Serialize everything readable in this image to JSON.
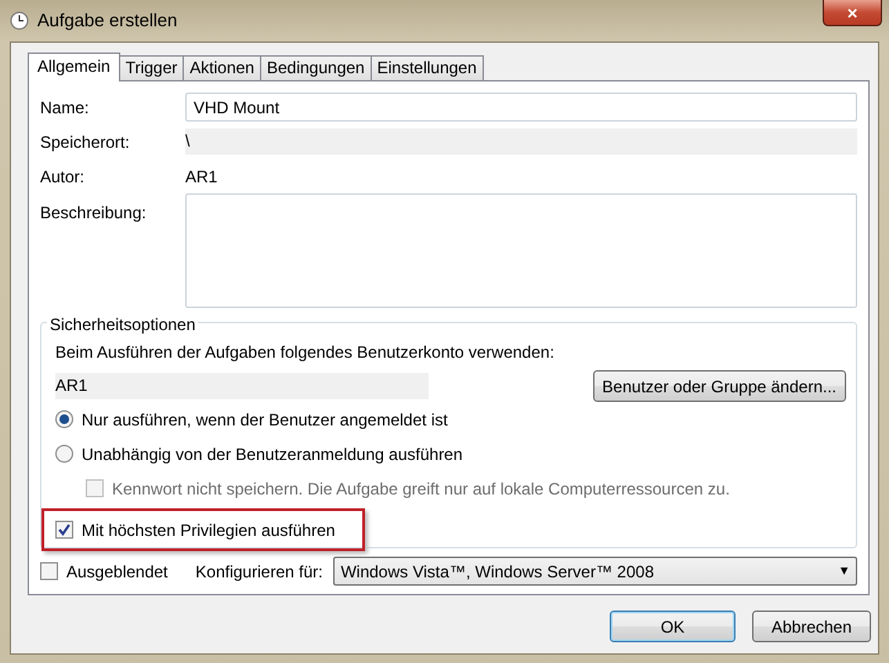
{
  "window": {
    "title": "Aufgabe erstellen",
    "close": "×"
  },
  "tabs": [
    {
      "label": "Allgemein",
      "selected": true
    },
    {
      "label": "Trigger",
      "selected": false
    },
    {
      "label": "Aktionen",
      "selected": false
    },
    {
      "label": "Bedingungen",
      "selected": false
    },
    {
      "label": "Einstellungen",
      "selected": false
    }
  ],
  "fields": [
    {
      "label": "Name:",
      "kind": "input",
      "value": "VHD Mount"
    },
    {
      "label": "Speicherort:",
      "kind": "readonly",
      "value": "\\"
    },
    {
      "label": "Autor:",
      "kind": "plain",
      "value": "AR1"
    },
    {
      "label": "Beschreibung:",
      "kind": "textarea"
    }
  ],
  "security": {
    "title": "Sicherheitsoptionen",
    "account_label": "Beim Ausführen der Aufgaben folgendes Benutzerkonto verwenden:",
    "account": "AR1",
    "change_button": "Benutzer oder Gruppe ändern...",
    "options": [
      {
        "kind": "radio",
        "label": "Nur ausführen, wenn der Benutzer angemeldet ist",
        "selected": true
      },
      {
        "kind": "radio",
        "label": "Unabhängig von der Benutzeranmeldung ausführen",
        "selected": false,
        "children": [
          {
            "kind": "checkbox",
            "label": "Kennwort nicht speichern. Die Aufgabe greift nur auf lokale Computerressourcen zu.",
            "checked": false,
            "disabled": true
          }
        ]
      }
    ],
    "privileges": {
      "label": "Mit höchsten Privilegien ausführen",
      "checked": true,
      "highlighted": true
    }
  },
  "hidden": {
    "label": "Ausgeblendet",
    "checked": false
  },
  "configure": {
    "label": "Konfigurieren für:",
    "value": "Windows Vista™, Windows Server™ 2008",
    "arrow": "▼"
  },
  "buttons": [
    {
      "label": "OK",
      "default": true
    },
    {
      "label": "Abbrechen",
      "default": false
    }
  ]
}
